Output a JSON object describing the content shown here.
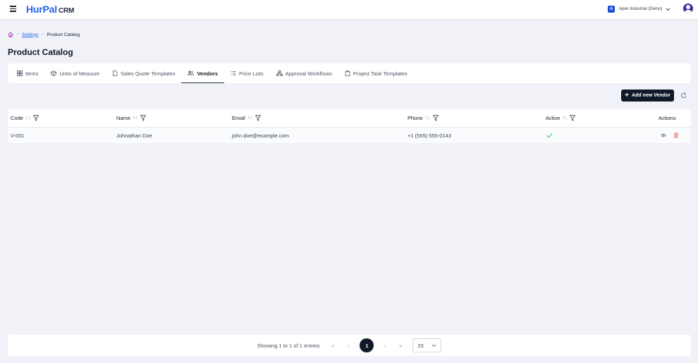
{
  "app": {
    "logo_main": "HurPal",
    "logo_suffix": "CRM",
    "company": "Apex Industrial (Demo)",
    "company_badge": "A"
  },
  "breadcrumb": {
    "settings": "Settings",
    "current": "Product Catalog"
  },
  "page_title": "Product Catalog",
  "tabs": [
    {
      "label": "Items",
      "icon": "grid-icon"
    },
    {
      "label": "Units of Measure",
      "icon": "box-icon"
    },
    {
      "label": "Sales Quote Templates",
      "icon": "file-icon"
    },
    {
      "label": "Vendors",
      "icon": "users-icon",
      "active": true
    },
    {
      "label": "Price Lists",
      "icon": "list-icon"
    },
    {
      "label": "Approval Workflows",
      "icon": "workflow-icon"
    },
    {
      "label": "Project Task Templates",
      "icon": "clipboard-icon"
    }
  ],
  "toolbar": {
    "add_label": "Add new Vendor"
  },
  "table": {
    "columns": {
      "code": "Code",
      "name": "Name",
      "email": "Email",
      "phone": "Phone",
      "active": "Active",
      "actions": "Actions"
    },
    "rows": [
      {
        "code": "V-001",
        "name": "Johnathan Doe",
        "email": "john.doe@example.com",
        "phone": "+1 (555) 555-0143",
        "active": true
      }
    ]
  },
  "pagination": {
    "summary": "Showing 1 to 1 of 1 entries",
    "first": "«",
    "prev": "‹",
    "page": "1",
    "next": "›",
    "last": "»",
    "page_size": "20"
  },
  "colors": {
    "brand": "#2563eb",
    "active_check": "#22c55e",
    "delete": "#ef4444",
    "dark": "#111827"
  }
}
